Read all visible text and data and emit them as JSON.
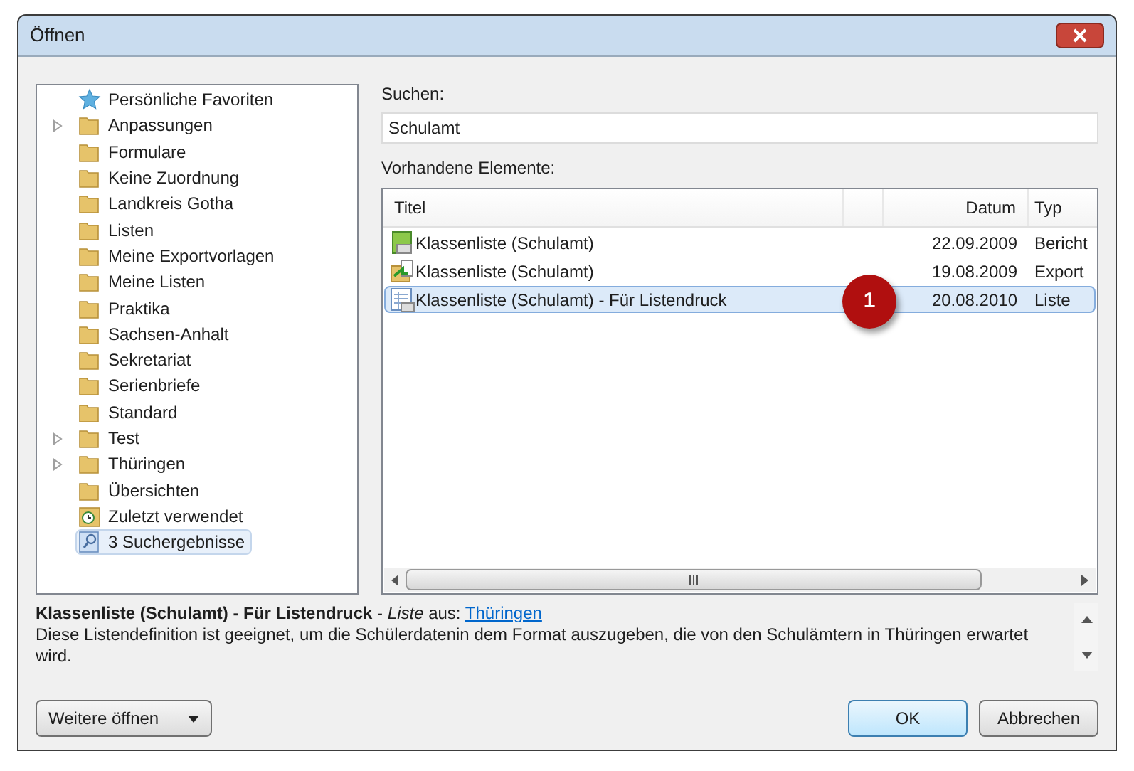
{
  "window": {
    "title": "Öffnen"
  },
  "tree": {
    "items": [
      {
        "label": "Persönliche Favoriten",
        "kind": "star",
        "expandable": false,
        "selected": false
      },
      {
        "label": "Anpassungen",
        "kind": "folder",
        "expandable": true,
        "selected": false
      },
      {
        "label": "Formulare",
        "kind": "folder",
        "expandable": false,
        "selected": false
      },
      {
        "label": "Keine Zuordnung",
        "kind": "folder",
        "expandable": false,
        "selected": false
      },
      {
        "label": "Landkreis Gotha",
        "kind": "folder",
        "expandable": false,
        "selected": false
      },
      {
        "label": "Listen",
        "kind": "folder",
        "expandable": false,
        "selected": false
      },
      {
        "label": "Meine Exportvorlagen",
        "kind": "folder",
        "expandable": false,
        "selected": false
      },
      {
        "label": "Meine Listen",
        "kind": "folder",
        "expandable": false,
        "selected": false
      },
      {
        "label": "Praktika",
        "kind": "folder",
        "expandable": false,
        "selected": false
      },
      {
        "label": "Sachsen-Anhalt",
        "kind": "folder",
        "expandable": false,
        "selected": false
      },
      {
        "label": "Sekretariat",
        "kind": "folder",
        "expandable": false,
        "selected": false
      },
      {
        "label": "Serienbriefe",
        "kind": "folder",
        "expandable": false,
        "selected": false
      },
      {
        "label": "Standard",
        "kind": "folder",
        "expandable": false,
        "selected": false
      },
      {
        "label": "Test",
        "kind": "folder",
        "expandable": true,
        "selected": false
      },
      {
        "label": "Thüringen",
        "kind": "folder",
        "expandable": true,
        "selected": false
      },
      {
        "label": "Übersichten",
        "kind": "folder",
        "expandable": false,
        "selected": false
      },
      {
        "label": "Zuletzt verwendet",
        "kind": "recent",
        "expandable": false,
        "selected": false
      },
      {
        "label": "3 Suchergebnisse",
        "kind": "search",
        "expandable": false,
        "selected": true
      }
    ]
  },
  "search": {
    "label": "Suchen:",
    "value": "Schulamt"
  },
  "table": {
    "label": "Vorhandene Elemente:",
    "columns": [
      "Titel",
      "",
      "Datum",
      "Typ"
    ],
    "rows": [
      {
        "title": "Klassenliste (Schulamt)",
        "date": "22.09.2009",
        "type": "Bericht",
        "kind": "report",
        "selected": false
      },
      {
        "title": "Klassenliste (Schulamt)",
        "date": "19.08.2009",
        "type": "Export",
        "kind": "export",
        "selected": false
      },
      {
        "title": "Klassenliste (Schulamt) - Für Listendruck",
        "date": "20.08.2010",
        "type": "Liste",
        "kind": "list",
        "selected": true
      }
    ]
  },
  "callout": {
    "label": "1"
  },
  "description": {
    "heading": "**Klassenliste (Schulamt) - Für Listendruck** - *Liste* aus:",
    "link": "Thüringen",
    "text": "Diese Listendefinition ist geeignet, um die Schülerdatenin dem Format auszugeben, die von den Schulämtern in Thüringen erwartet wird."
  },
  "buttons": {
    "more": "Weitere öffnen",
    "ok": "OK",
    "cancel": "Abbrechen"
  }
}
